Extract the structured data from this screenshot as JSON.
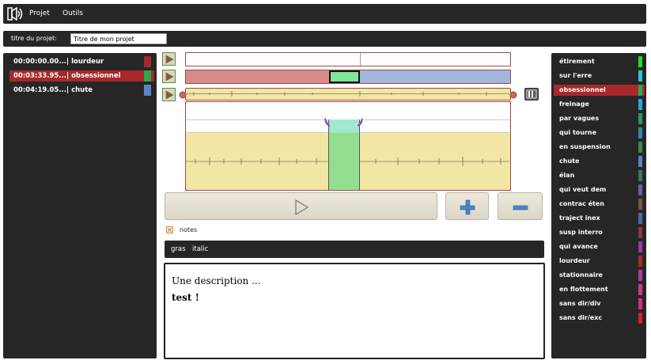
{
  "menu": {
    "items": [
      "Projet",
      "Outils"
    ]
  },
  "project": {
    "title_label": "titre du projet:",
    "title_value": "Titre de mon projet"
  },
  "segments": [
    {
      "label": "00:00:00.00...| lourdeur",
      "color": "#a8282b",
      "selected": false
    },
    {
      "label": "00:03:33.95...| obsessionnel",
      "color": "#2aaa4a",
      "selected": true
    },
    {
      "label": "00:04:19.05...| chute",
      "color": "#5a82c8",
      "selected": false
    }
  ],
  "categories": [
    {
      "label": "étirement",
      "color": "#22dd22",
      "selected": false
    },
    {
      "label": "sur l'erre",
      "color": "#22c8dd",
      "selected": false
    },
    {
      "label": "obsessionnel",
      "color": "#2aaa4a",
      "selected": true
    },
    {
      "label": "freinage",
      "color": "#22a8dd",
      "selected": false
    },
    {
      "label": "par vagues",
      "color": "#2a9a5a",
      "selected": false
    },
    {
      "label": "qui tourne",
      "color": "#2a8aaa",
      "selected": false
    },
    {
      "label": "en suspension",
      "color": "#3a8a4a",
      "selected": false
    },
    {
      "label": "chute",
      "color": "#5a82c8",
      "selected": false
    },
    {
      "label": "élan",
      "color": "#3a7a5a",
      "selected": false
    },
    {
      "label": "qui veut dem",
      "color": "#6a5aaa",
      "selected": false
    },
    {
      "label": "contrac éten",
      "color": "#7a5a3a",
      "selected": false
    },
    {
      "label": "traject inex",
      "color": "#4a6aaa",
      "selected": false
    },
    {
      "label": "susp interro",
      "color": "#8a3a3a",
      "selected": false
    },
    {
      "label": "qui avance",
      "color": "#9a3aaa",
      "selected": false
    },
    {
      "label": "lourdeur",
      "color": "#a8282b",
      "selected": false
    },
    {
      "label": "stationnaire",
      "color": "#aa3aaa",
      "selected": false
    },
    {
      "label": "en flottement",
      "color": "#c83a9a",
      "selected": false
    },
    {
      "label": "sans dir/div",
      "color": "#d82a8a",
      "selected": false
    },
    {
      "label": "sans dir/exc",
      "color": "#dd1a2a",
      "selected": false
    }
  ],
  "notes": {
    "label": "notes",
    "checked": true
  },
  "format": {
    "bold": "gras",
    "italic": "italic"
  },
  "editor": {
    "line1": "Une description ...",
    "line2": "test !"
  }
}
